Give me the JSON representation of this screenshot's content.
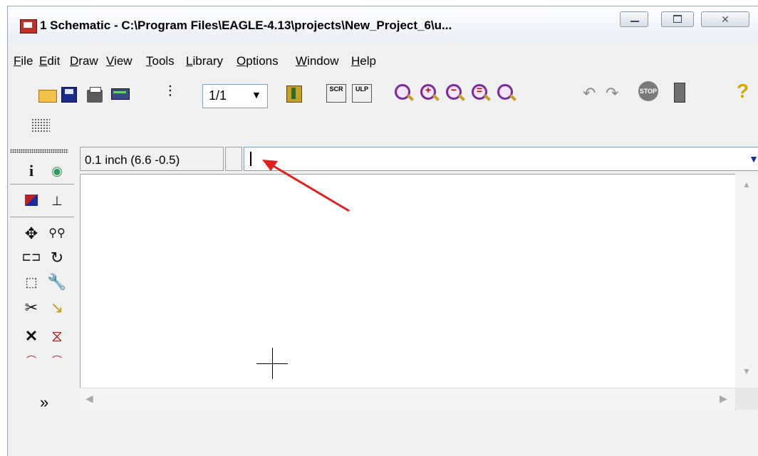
{
  "window": {
    "title": "1 Schematic - C:\\Program Files\\EAGLE-4.13\\projects\\New_Project_6\\u...",
    "close_glyph": "✕"
  },
  "menu": [
    "File",
    "Edit",
    "Draw",
    "View",
    "Tools",
    "Library",
    "Options",
    "Window",
    "Help"
  ],
  "toolbar": {
    "sheet_value": "1/1",
    "scr_label": "SCR",
    "ulp_label": "ULP",
    "stop_label": "STOP",
    "help_glyph": "?",
    "undo_glyph": "↶",
    "redo_glyph": "↷",
    "dropdown_glyph": "▼"
  },
  "coords": {
    "text": "0.1 inch (6.6 -0.5)"
  },
  "command": {
    "value": ""
  },
  "tools": {
    "info": "i",
    "show": "👁",
    "move": "✥",
    "delete": "✕",
    "more": "»"
  },
  "annotation": {
    "color": "#e02020"
  }
}
